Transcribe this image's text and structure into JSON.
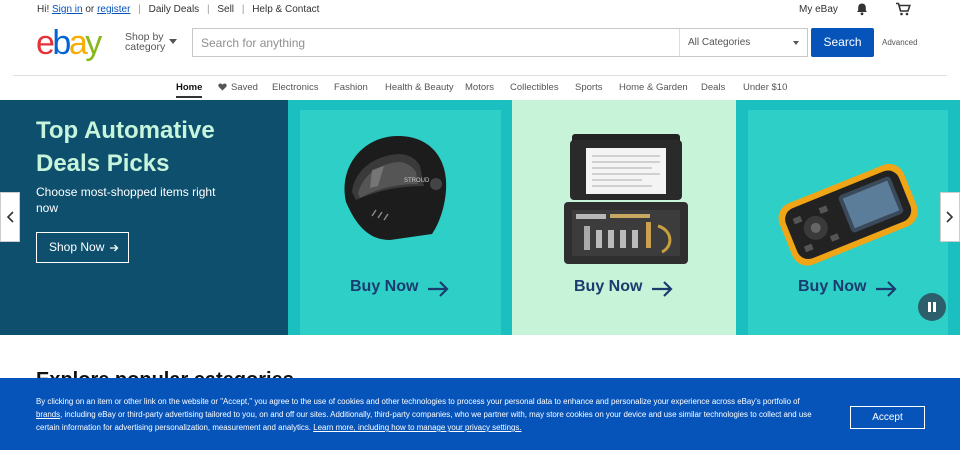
{
  "topbar": {
    "greeting": "Hi!",
    "sign_in": "Sign in",
    "or": "or",
    "register": "register",
    "daily_deals": "Daily Deals",
    "sell": "Sell",
    "help_contact": "Help & Contact",
    "my_ebay": "My eBay",
    "bell_icon": "bell-icon",
    "cart_icon": "cart-icon"
  },
  "header": {
    "logo_text": "ebay",
    "shop_by_line1": "Shop by",
    "shop_by_line2": "category",
    "search_placeholder": "Search for anything",
    "category_selected": "All Categories",
    "search_button": "Search",
    "advanced": "Advanced"
  },
  "nav": {
    "items": [
      "Home",
      "Saved",
      "Electronics",
      "Fashion",
      "Health & Beauty",
      "Motors",
      "Collectibles",
      "Sports",
      "Home & Garden",
      "Deals",
      "Under $10"
    ]
  },
  "hero": {
    "title": "Top Automative Deals Picks",
    "subtitle": "Choose most-shopped items right now",
    "cta": "Shop Now",
    "cards": [
      {
        "label": "Buy Now",
        "image": "helmet"
      },
      {
        "label": "Buy Now",
        "image": "tool-kit"
      },
      {
        "label": "Buy Now",
        "image": "diagnostic-scanner"
      }
    ]
  },
  "section": {
    "explore_title": "Explore popular categories"
  },
  "cookie": {
    "part1": "By clicking on an item or other link on the website or \"Accept,\" you agree to the use of cookies and other technologies to process your personal data to enhance and personalize your experience across eBay's portfolio of ",
    "brands_link": "brands",
    "part2": ", including eBay or third-party advertising tailored to you, on and off our sites. Additionally, third-party companies, who we partner with, may store cookies on your device and use similar technologies to collect and use certain information for advertising personalization, measurement and analytics. ",
    "learn_more": "Learn more, including how to manage your privacy settings.",
    "accept": "Accept"
  },
  "colors": {
    "brand_blue": "#0654ba",
    "hero_dark": "#0e4f6e",
    "teal": "#1bbfbf",
    "mint": "#c7f3d8",
    "logo_red": "#e53238",
    "logo_blue": "#0064d2",
    "logo_yellow": "#f5af02",
    "logo_green": "#86b817"
  }
}
